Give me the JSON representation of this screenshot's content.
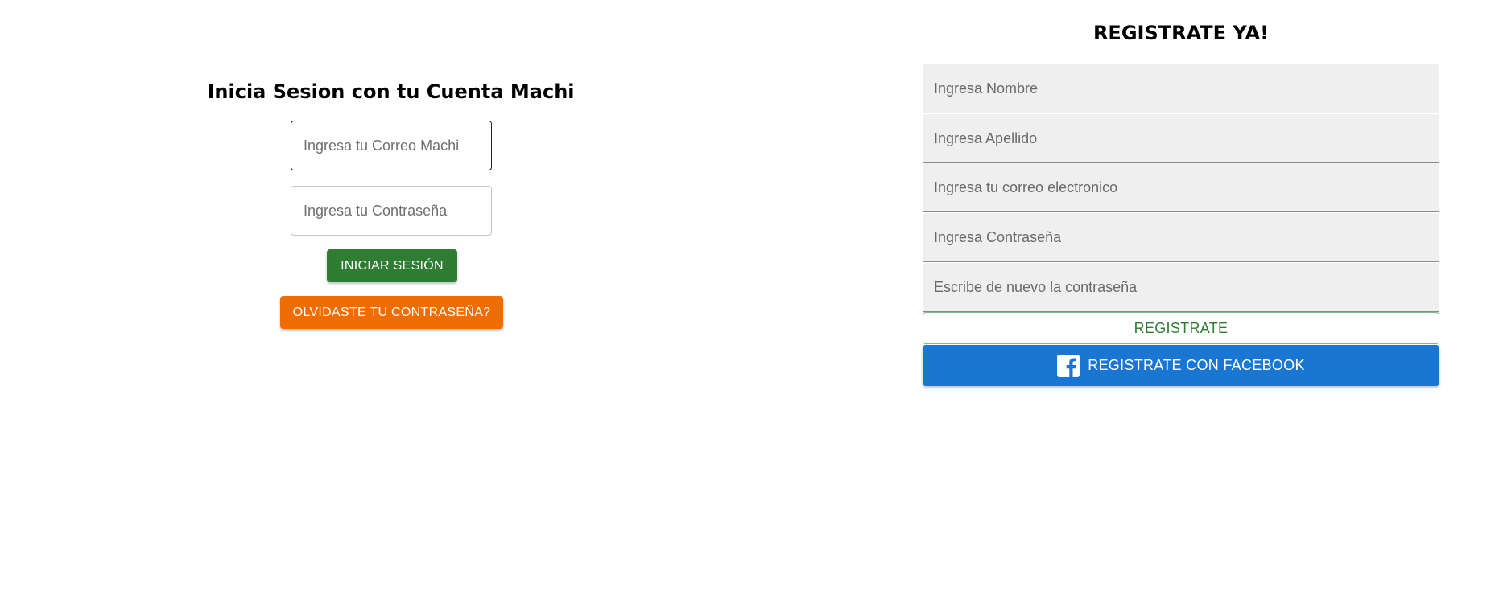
{
  "login": {
    "title": "Inicia Sesion con tu Cuenta Machi",
    "email_placeholder": "Ingresa tu Correo Machi",
    "password_placeholder": "Ingresa tu Contraseña",
    "login_button": "INICIAR SESIÓN",
    "forgot_button": "OLVIDASTE TU CONTRASEÑA?"
  },
  "register": {
    "title": "REGISTRATE YA!",
    "fields": [
      {
        "placeholder": "Ingresa Nombre"
      },
      {
        "placeholder": "Ingresa Apellido"
      },
      {
        "placeholder": "Ingresa tu correo electronico"
      },
      {
        "placeholder": "Ingresa Contraseña"
      },
      {
        "placeholder": "Escribe de nuevo la contraseña"
      }
    ],
    "register_button": "REGISTRATE",
    "facebook_button": "REGISTRATE CON FACEBOOK",
    "facebook_icon": "facebook-icon"
  },
  "colors": {
    "login_button": "#2e7d32",
    "forgot_button": "#ef6c00",
    "facebook_button": "#1976d2",
    "register_text": "#2e7d32",
    "field_background": "#efefef"
  }
}
